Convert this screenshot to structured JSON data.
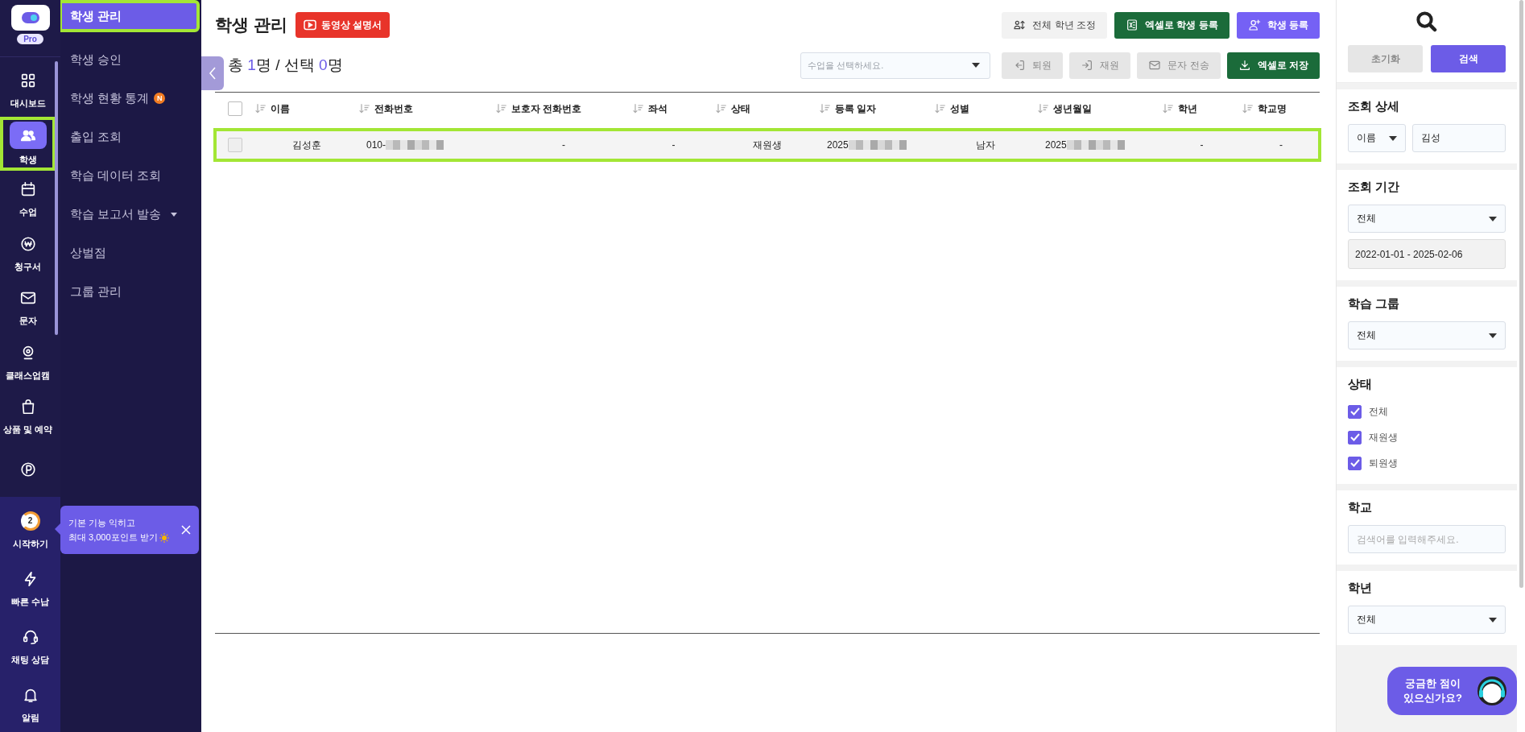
{
  "app": {
    "badge": "Pro"
  },
  "nav": [
    {
      "label": "대시보드",
      "selected": false,
      "highlighted": false
    },
    {
      "label": "학생",
      "selected": true,
      "highlighted": true
    },
    {
      "label": "수업",
      "selected": false,
      "highlighted": false
    },
    {
      "label": "청구서",
      "selected": false,
      "highlighted": false
    },
    {
      "label": "문자",
      "selected": false,
      "highlighted": false
    },
    {
      "label": "클래스업캠",
      "selected": false,
      "highlighted": false
    },
    {
      "label": "상품 및 예약",
      "selected": false,
      "highlighted": false
    },
    {
      "selected": false,
      "highlighted": false
    }
  ],
  "nav_bottom": [
    {
      "label": "시작하기",
      "badge": "2"
    },
    {
      "label": "빠른 수납"
    },
    {
      "label": "채팅 상담"
    },
    {
      "label": "알림"
    }
  ],
  "tooltip": {
    "lines": [
      "기본 기능 익히고",
      "최대 3,000포인트 받기"
    ]
  },
  "sidebar": {
    "items": [
      {
        "label": "학생 관리",
        "selected": true,
        "highlighted": true
      },
      {
        "label": "학생 승인",
        "selected": false,
        "highlighted": false
      },
      {
        "label": "학생 현황 통계",
        "selected": false,
        "highlighted": false,
        "badge": "N"
      },
      {
        "label": "출입 조회",
        "selected": false,
        "highlighted": false
      },
      {
        "label": "학습 데이터 조회",
        "selected": false,
        "highlighted": false
      },
      {
        "label": "학습 보고서 발송",
        "selected": false,
        "highlighted": false,
        "expanded": false
      },
      {
        "label": "상벌점",
        "selected": false,
        "highlighted": false
      },
      {
        "label": "그룹 관리",
        "selected": false,
        "highlighted": false
      }
    ]
  },
  "page": {
    "title": "학생 관리",
    "video_button": "동영상 설명서"
  },
  "top_buttons": [
    {
      "label": "전체 학년 조정",
      "kind": "light"
    },
    {
      "label": "엑셀로 학생 등록",
      "kind": "green"
    },
    {
      "label": "학생 등록",
      "kind": "purple"
    }
  ],
  "summary": {
    "total_label": "총",
    "total": "1",
    "unit": "명",
    "selected_label": "/ 선택",
    "selected_count": "0",
    "selected_unit": "명"
  },
  "class_select": {
    "placeholder": "수업을 선택하세요."
  },
  "actions": [
    {
      "label": "퇴원",
      "disabled": true
    },
    {
      "label": "재원",
      "disabled": true
    },
    {
      "label": "문자 전송",
      "disabled": true
    },
    {
      "label": "엑셀로 저장",
      "disabled": false
    }
  ],
  "table": {
    "header_checked": false,
    "columns": [
      "이름",
      "전화번호",
      "보호자 전화번호",
      "좌석",
      "상태",
      "등록 일자",
      "성별",
      "생년월일",
      "학년",
      "학교명"
    ],
    "rows": [
      {
        "selected": false,
        "highlighted": true,
        "cells": [
          {
            "text": "김성훈",
            "blurred": false
          },
          {
            "text": "010-",
            "blurred": true
          },
          {
            "text": "-",
            "blurred": false
          },
          {
            "text": "-",
            "blurred": false
          },
          {
            "text": "재원생",
            "blurred": false
          },
          {
            "text": "2025",
            "blurred": true
          },
          {
            "text": "남자",
            "blurred": false
          },
          {
            "text": "2025",
            "blurred": true
          },
          {
            "text": "-",
            "blurred": false
          },
          {
            "text": "-",
            "blurred": false
          }
        ]
      }
    ]
  },
  "filter": {
    "reset_button": "초기화",
    "search_button": "검색",
    "sections": [
      {
        "title": "조회 상세",
        "controls": [
          {
            "kind": "pair",
            "select": "이름",
            "value": "김성"
          }
        ]
      },
      {
        "title": "조회 기간",
        "controls": [
          {
            "kind": "select",
            "value": "전체"
          },
          {
            "kind": "range",
            "value": "2022-01-01 - 2025-02-06"
          }
        ]
      },
      {
        "title": "학습 그룹",
        "controls": [
          {
            "kind": "select",
            "value": "전체"
          }
        ]
      },
      {
        "title": "상태",
        "controls": [
          {
            "kind": "checkbox",
            "label": "전체",
            "checked": true
          },
          {
            "kind": "checkbox",
            "label": "재원생",
            "checked": true
          },
          {
            "kind": "checkbox",
            "label": "퇴원생",
            "checked": true
          }
        ]
      },
      {
        "title": "학교",
        "controls": [
          {
            "kind": "input",
            "placeholder": "검색어를 입력해주세요."
          }
        ]
      },
      {
        "title": "학년",
        "controls": [
          {
            "kind": "select",
            "value": "전체"
          }
        ]
      }
    ]
  },
  "chat_button": {
    "text": "궁금한 점이\n있으신가요?"
  }
}
